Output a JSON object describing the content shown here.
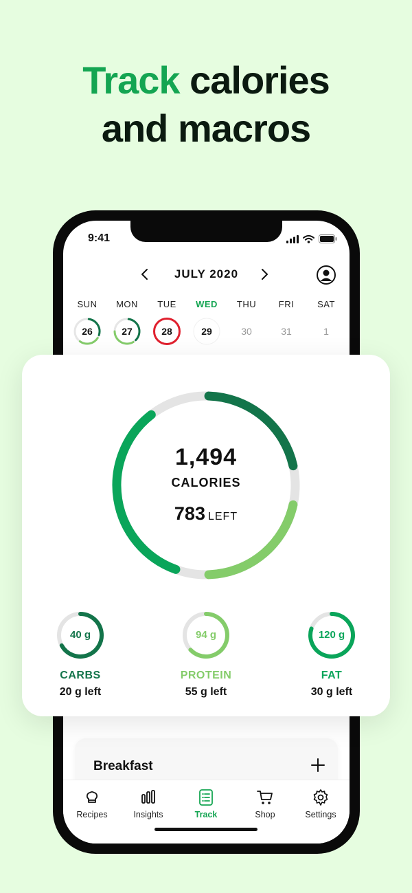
{
  "headline": {
    "accent": "Track",
    "rest_line1": " calories",
    "line2": "and macros"
  },
  "status": {
    "time": "9:41"
  },
  "calendar": {
    "month": "JULY 2020",
    "days": [
      {
        "name": "SUN",
        "num": "26",
        "state": "partial",
        "progress": 0.6
      },
      {
        "name": "MON",
        "num": "27",
        "state": "partial",
        "progress": 0.75
      },
      {
        "name": "TUE",
        "num": "28",
        "state": "over",
        "progress": 1.0
      },
      {
        "name": "WED",
        "num": "29",
        "state": "today",
        "progress": 0
      },
      {
        "name": "THU",
        "num": "30",
        "state": "future",
        "progress": 0
      },
      {
        "name": "FRI",
        "num": "31",
        "state": "future",
        "progress": 0
      },
      {
        "name": "SAT",
        "num": "1",
        "state": "future",
        "progress": 0
      }
    ]
  },
  "summary": {
    "calories": "1,494",
    "calories_label": "CALORIES",
    "left_value": "783",
    "left_label": "LEFT",
    "ring_segments": [
      {
        "name": "carbs",
        "fraction": 0.21,
        "color": "#13744a"
      },
      {
        "name": "protein",
        "fraction": 0.21,
        "color": "#84cc6a"
      },
      {
        "name": "fat",
        "fraction": 0.34,
        "color": "#0aa55a"
      }
    ]
  },
  "macros": [
    {
      "value": "40 g",
      "name": "CARBS",
      "left": "20 g left",
      "progress": 0.67,
      "color": "#13744a"
    },
    {
      "value": "94 g",
      "name": "PROTEIN",
      "left": "55 g left",
      "progress": 0.63,
      "color": "#84cc6a"
    },
    {
      "value": "120 g",
      "name": "FAT",
      "left": "30 g left",
      "progress": 0.8,
      "color": "#0aa55a"
    }
  ],
  "meal": {
    "title": "Breakfast"
  },
  "tabs": [
    {
      "label": "Recipes",
      "icon": "chef-hat-icon"
    },
    {
      "label": "Insights",
      "icon": "bar-chart-icon"
    },
    {
      "label": "Track",
      "icon": "list-icon",
      "active": true
    },
    {
      "label": "Shop",
      "icon": "cart-icon"
    },
    {
      "label": "Settings",
      "icon": "gear-icon"
    }
  ],
  "colors": {
    "accent": "#14a552",
    "background": "#e6fde0",
    "over": "#e0202e"
  }
}
